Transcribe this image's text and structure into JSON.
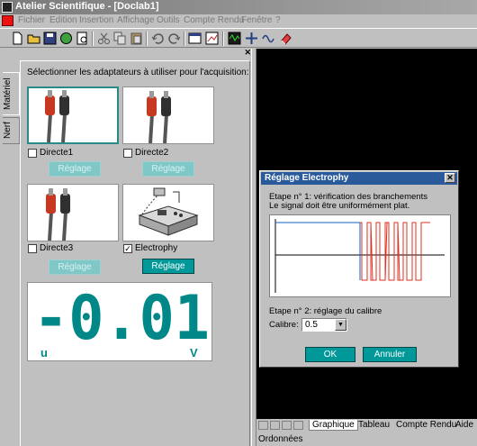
{
  "window": {
    "title": "Atelier Scientifique - [Doclab1]"
  },
  "menu": [
    "Fichier",
    "Edition",
    "Insertion",
    "Affichage",
    "Outils",
    "Compte Rendu",
    "Fenêtre",
    "?"
  ],
  "side_tabs": {
    "materiel": "Matériel",
    "nerf": "Nerf"
  },
  "panel": {
    "instruction": "Sélectionner les adaptateurs à utiliser pour l'acquisition:",
    "adapters": [
      {
        "label": "Directe1",
        "checked": false,
        "button": "Réglage",
        "button_enabled": false
      },
      {
        "label": "Directe2",
        "checked": false,
        "button": "Réglage",
        "button_enabled": false
      },
      {
        "label": "Directe3",
        "checked": false,
        "button": "Réglage",
        "button_enabled": false
      },
      {
        "label": "Electrophy",
        "checked": true,
        "button": "Réglage",
        "button_enabled": true
      }
    ],
    "checkmark": "✓",
    "display": {
      "value": "-0.01",
      "unit_left": "u",
      "unit_right": "V"
    }
  },
  "dialog": {
    "title": "Réglage Electrophy",
    "step1_line1": "Etape n° 1: vérification des branchements",
    "step1_line2": "Le signal doit être uniformément plat.",
    "step2": "Etape n° 2: réglage du calibre",
    "calibre_label": "Calibre:",
    "calibre_value": "0.5",
    "ok": "OK",
    "cancel": "Annuler"
  },
  "bottom_tabs": [
    "Graphique",
    "Tableau",
    "Compte Rendu",
    "Aide"
  ],
  "status": "Ordonnées",
  "colors": {
    "accent": "#009898",
    "dialog_title": "#2a5a9a",
    "signal": "#e03020"
  }
}
